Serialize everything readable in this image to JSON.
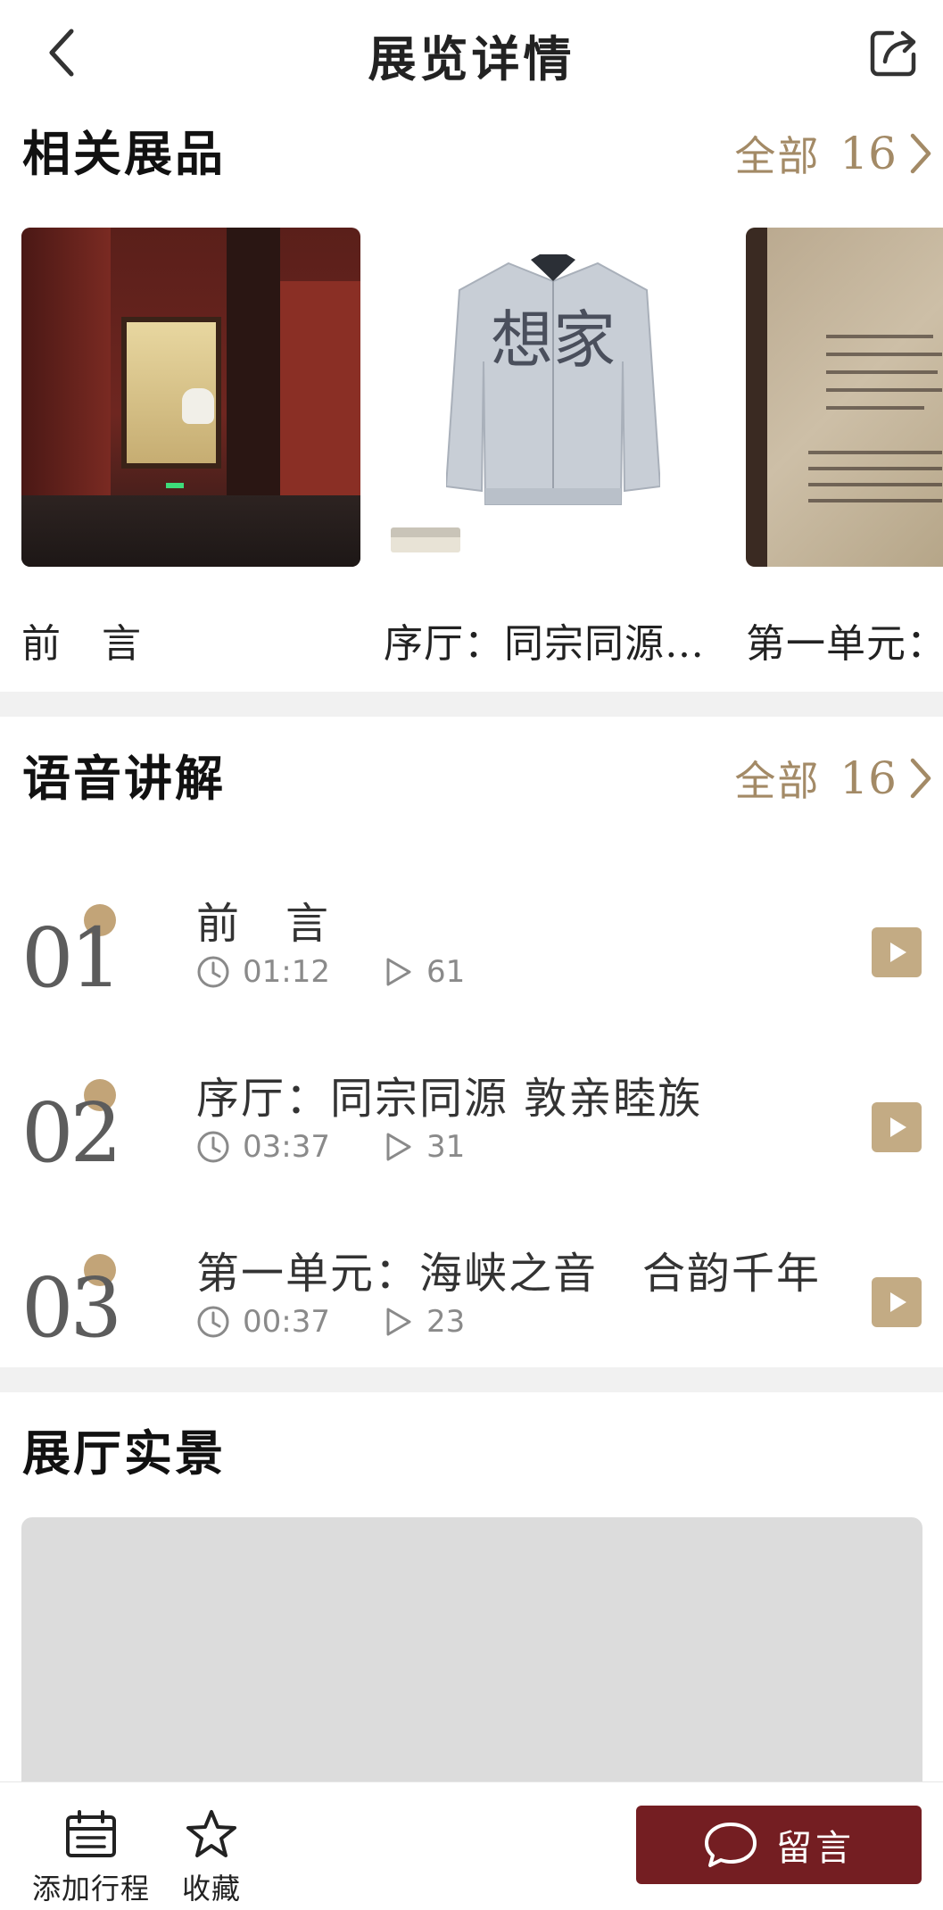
{
  "header": {
    "title": "展览详情"
  },
  "exhibits_section": {
    "title": "相关展品",
    "more_label": "全部",
    "more_count": "16",
    "items": [
      {
        "caption": "前　言"
      },
      {
        "caption": "序厅：同宗同源…"
      },
      {
        "caption": "第一单元：海"
      }
    ],
    "jacket_text": "想家"
  },
  "audio_section": {
    "title": "语音讲解",
    "more_label": "全部",
    "more_count": "16",
    "items": [
      {
        "number": "01",
        "title": "前　言",
        "duration": "01:12",
        "plays": "61"
      },
      {
        "number": "02",
        "title": "序厅：同宗同源  敦亲睦族",
        "duration": "03:37",
        "plays": "31"
      },
      {
        "number": "03",
        "title": "第一单元：海峡之音　合韵千年",
        "duration": "00:37",
        "plays": "23"
      }
    ]
  },
  "gallery_section": {
    "title": "展厅实景"
  },
  "bottom_bar": {
    "add_schedule": "添加行程",
    "favorite": "收藏",
    "comment": "留言"
  },
  "colors": {
    "accent_gold": "#a38a66",
    "play_button": "#c3ab84",
    "comment_button": "#741e22"
  }
}
